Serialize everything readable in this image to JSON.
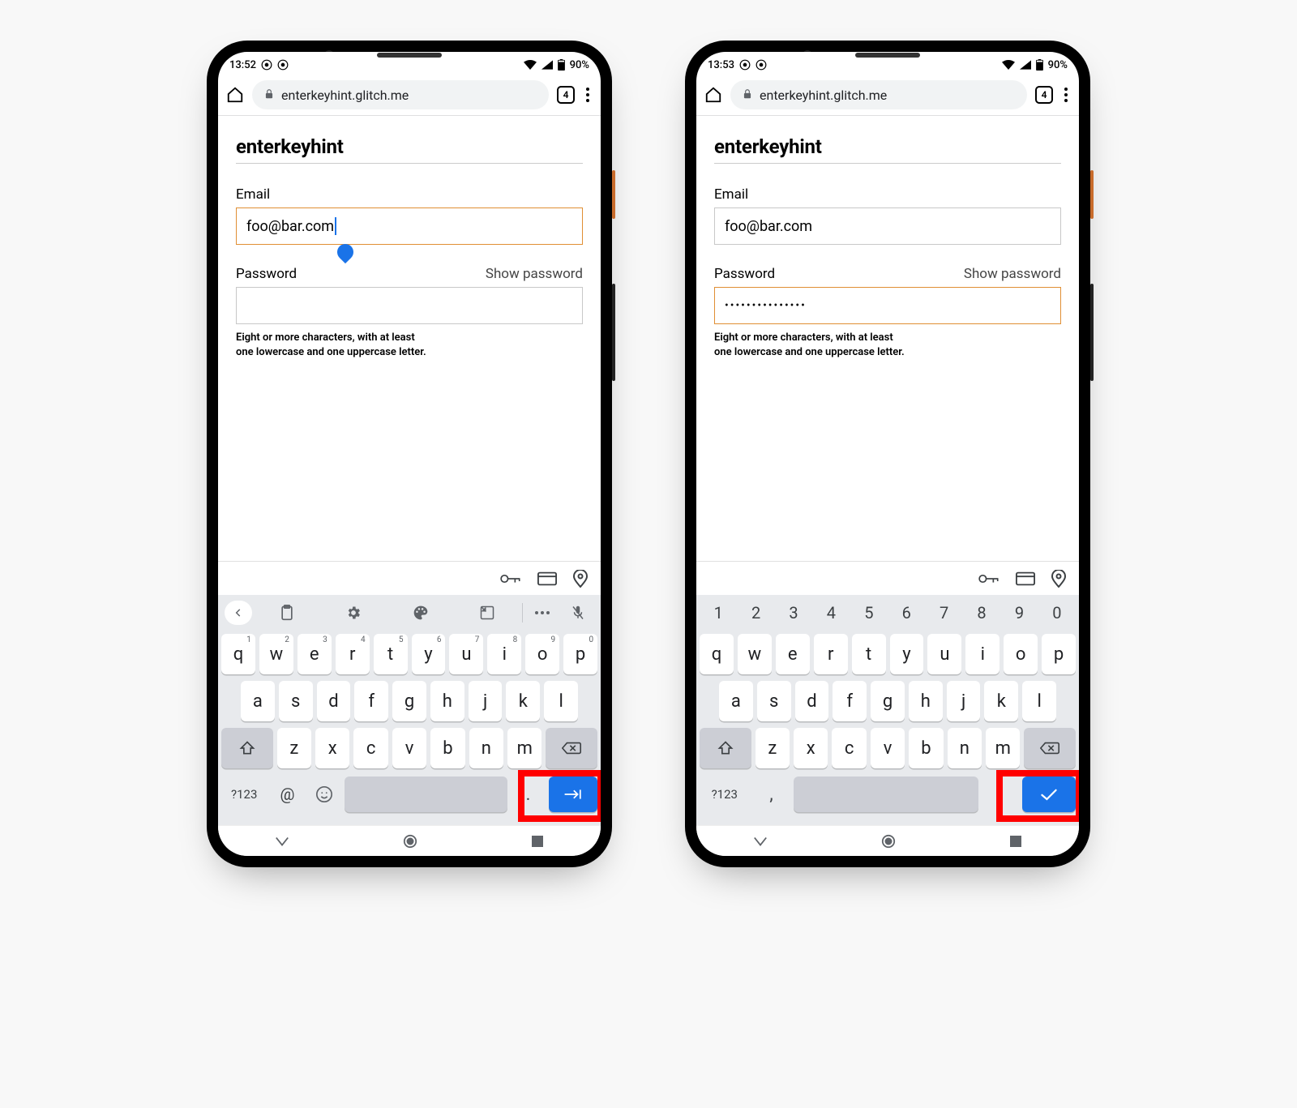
{
  "screens": [
    {
      "status": {
        "time": "13:52",
        "battery": "90%"
      },
      "url": "enterkeyhint.glitch.me",
      "tab_count": "4",
      "page": {
        "title": "enterkeyhint",
        "email_label": "Email",
        "email_value": "foo@bar.com",
        "password_label": "Password",
        "show_password": "Show password",
        "password_value": "",
        "password_helper_l1": "Eight or more characters, with at least",
        "password_helper_l2": "one lowercase and one uppercase letter.",
        "focused_field": "email"
      },
      "keyboard": {
        "mode": "email",
        "toolbar_icons": [
          "chevron-left",
          "clipboard",
          "gear",
          "palette",
          "sticker",
          "ellipsis",
          "mic-off"
        ],
        "row1": [
          {
            "k": "q",
            "sup": "1"
          },
          {
            "k": "w",
            "sup": "2"
          },
          {
            "k": "e",
            "sup": "3"
          },
          {
            "k": "r",
            "sup": "4"
          },
          {
            "k": "t",
            "sup": "5"
          },
          {
            "k": "y",
            "sup": "6"
          },
          {
            "k": "u",
            "sup": "7"
          },
          {
            "k": "i",
            "sup": "8"
          },
          {
            "k": "o",
            "sup": "9"
          },
          {
            "k": "p",
            "sup": "0"
          }
        ],
        "row2": [
          "a",
          "s",
          "d",
          "f",
          "g",
          "h",
          "j",
          "k",
          "l"
        ],
        "row3": [
          "z",
          "x",
          "c",
          "v",
          "b",
          "n",
          "m"
        ],
        "bottom": {
          "switch": "?123",
          "sym": "@",
          "emoji": true,
          "dot": ".",
          "enter": "next"
        }
      }
    },
    {
      "status": {
        "time": "13:53",
        "battery": "90%"
      },
      "url": "enterkeyhint.glitch.me",
      "tab_count": "4",
      "page": {
        "title": "enterkeyhint",
        "email_label": "Email",
        "email_value": "foo@bar.com",
        "password_label": "Password",
        "show_password": "Show password",
        "password_value": "•••••••••••••••",
        "password_helper_l1": "Eight or more characters, with at least",
        "password_helper_l2": "one lowercase and one uppercase letter.",
        "focused_field": "password"
      },
      "keyboard": {
        "mode": "password",
        "number_row": [
          "1",
          "2",
          "3",
          "4",
          "5",
          "6",
          "7",
          "8",
          "9",
          "0"
        ],
        "row1": [
          {
            "k": "q"
          },
          {
            "k": "w"
          },
          {
            "k": "e"
          },
          {
            "k": "r"
          },
          {
            "k": "t"
          },
          {
            "k": "y"
          },
          {
            "k": "u"
          },
          {
            "k": "i"
          },
          {
            "k": "o"
          },
          {
            "k": "p"
          }
        ],
        "row2": [
          "a",
          "s",
          "d",
          "f",
          "g",
          "h",
          "j",
          "k",
          "l"
        ],
        "row3": [
          "z",
          "x",
          "c",
          "v",
          "b",
          "n",
          "m"
        ],
        "bottom": {
          "switch": "?123",
          "sym": ",",
          "emoji": false,
          "dot": ".",
          "enter": "done"
        }
      }
    }
  ]
}
